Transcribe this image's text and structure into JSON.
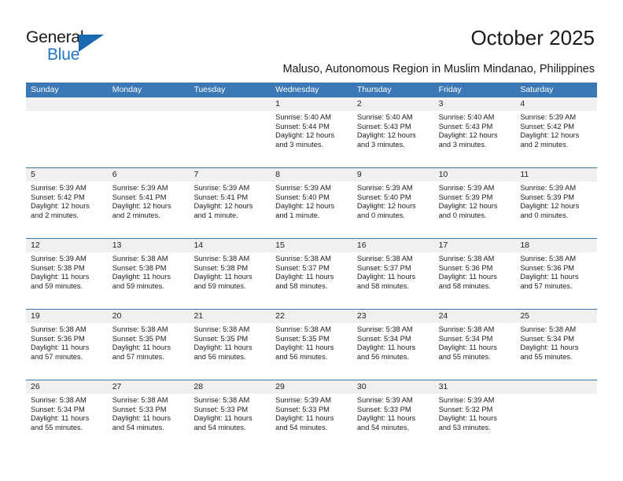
{
  "logo": {
    "word1": "General",
    "word2": "Blue",
    "triangle_color": "#1b69b0",
    "blue_color": "#2077c0"
  },
  "header": {
    "title": "October 2025",
    "subtitle": "Maluso, Autonomous Region in Muslim Mindanao, Philippines"
  },
  "theme": {
    "header_blue": "#3b78b5",
    "daynum_band": "#f0f0f0",
    "text": "#1e1e1e"
  },
  "calendar": {
    "weekday_headers": [
      "Sunday",
      "Monday",
      "Tuesday",
      "Wednesday",
      "Thursday",
      "Friday",
      "Saturday"
    ],
    "weeks": [
      [
        {
          "day": "",
          "lines": []
        },
        {
          "day": "",
          "lines": []
        },
        {
          "day": "",
          "lines": []
        },
        {
          "day": "1",
          "lines": [
            "Sunrise: 5:40 AM",
            "Sunset: 5:44 PM",
            "Daylight: 12 hours",
            "and 3 minutes."
          ]
        },
        {
          "day": "2",
          "lines": [
            "Sunrise: 5:40 AM",
            "Sunset: 5:43 PM",
            "Daylight: 12 hours",
            "and 3 minutes."
          ]
        },
        {
          "day": "3",
          "lines": [
            "Sunrise: 5:40 AM",
            "Sunset: 5:43 PM",
            "Daylight: 12 hours",
            "and 3 minutes."
          ]
        },
        {
          "day": "4",
          "lines": [
            "Sunrise: 5:39 AM",
            "Sunset: 5:42 PM",
            "Daylight: 12 hours",
            "and 2 minutes."
          ]
        }
      ],
      [
        {
          "day": "5",
          "lines": [
            "Sunrise: 5:39 AM",
            "Sunset: 5:42 PM",
            "Daylight: 12 hours",
            "and 2 minutes."
          ]
        },
        {
          "day": "6",
          "lines": [
            "Sunrise: 5:39 AM",
            "Sunset: 5:41 PM",
            "Daylight: 12 hours",
            "and 2 minutes."
          ]
        },
        {
          "day": "7",
          "lines": [
            "Sunrise: 5:39 AM",
            "Sunset: 5:41 PM",
            "Daylight: 12 hours",
            "and 1 minute."
          ]
        },
        {
          "day": "8",
          "lines": [
            "Sunrise: 5:39 AM",
            "Sunset: 5:40 PM",
            "Daylight: 12 hours",
            "and 1 minute."
          ]
        },
        {
          "day": "9",
          "lines": [
            "Sunrise: 5:39 AM",
            "Sunset: 5:40 PM",
            "Daylight: 12 hours",
            "and 0 minutes."
          ]
        },
        {
          "day": "10",
          "lines": [
            "Sunrise: 5:39 AM",
            "Sunset: 5:39 PM",
            "Daylight: 12 hours",
            "and 0 minutes."
          ]
        },
        {
          "day": "11",
          "lines": [
            "Sunrise: 5:39 AM",
            "Sunset: 5:39 PM",
            "Daylight: 12 hours",
            "and 0 minutes."
          ]
        }
      ],
      [
        {
          "day": "12",
          "lines": [
            "Sunrise: 5:39 AM",
            "Sunset: 5:38 PM",
            "Daylight: 11 hours",
            "and 59 minutes."
          ]
        },
        {
          "day": "13",
          "lines": [
            "Sunrise: 5:38 AM",
            "Sunset: 5:38 PM",
            "Daylight: 11 hours",
            "and 59 minutes."
          ]
        },
        {
          "day": "14",
          "lines": [
            "Sunrise: 5:38 AM",
            "Sunset: 5:38 PM",
            "Daylight: 11 hours",
            "and 59 minutes."
          ]
        },
        {
          "day": "15",
          "lines": [
            "Sunrise: 5:38 AM",
            "Sunset: 5:37 PM",
            "Daylight: 11 hours",
            "and 58 minutes."
          ]
        },
        {
          "day": "16",
          "lines": [
            "Sunrise: 5:38 AM",
            "Sunset: 5:37 PM",
            "Daylight: 11 hours",
            "and 58 minutes."
          ]
        },
        {
          "day": "17",
          "lines": [
            "Sunrise: 5:38 AM",
            "Sunset: 5:36 PM",
            "Daylight: 11 hours",
            "and 58 minutes."
          ]
        },
        {
          "day": "18",
          "lines": [
            "Sunrise: 5:38 AM",
            "Sunset: 5:36 PM",
            "Daylight: 11 hours",
            "and 57 minutes."
          ]
        }
      ],
      [
        {
          "day": "19",
          "lines": [
            "Sunrise: 5:38 AM",
            "Sunset: 5:36 PM",
            "Daylight: 11 hours",
            "and 57 minutes."
          ]
        },
        {
          "day": "20",
          "lines": [
            "Sunrise: 5:38 AM",
            "Sunset: 5:35 PM",
            "Daylight: 11 hours",
            "and 57 minutes."
          ]
        },
        {
          "day": "21",
          "lines": [
            "Sunrise: 5:38 AM",
            "Sunset: 5:35 PM",
            "Daylight: 11 hours",
            "and 56 minutes."
          ]
        },
        {
          "day": "22",
          "lines": [
            "Sunrise: 5:38 AM",
            "Sunset: 5:35 PM",
            "Daylight: 11 hours",
            "and 56 minutes."
          ]
        },
        {
          "day": "23",
          "lines": [
            "Sunrise: 5:38 AM",
            "Sunset: 5:34 PM",
            "Daylight: 11 hours",
            "and 56 minutes."
          ]
        },
        {
          "day": "24",
          "lines": [
            "Sunrise: 5:38 AM",
            "Sunset: 5:34 PM",
            "Daylight: 11 hours",
            "and 55 minutes."
          ]
        },
        {
          "day": "25",
          "lines": [
            "Sunrise: 5:38 AM",
            "Sunset: 5:34 PM",
            "Daylight: 11 hours",
            "and 55 minutes."
          ]
        }
      ],
      [
        {
          "day": "26",
          "lines": [
            "Sunrise: 5:38 AM",
            "Sunset: 5:34 PM",
            "Daylight: 11 hours",
            "and 55 minutes."
          ]
        },
        {
          "day": "27",
          "lines": [
            "Sunrise: 5:38 AM",
            "Sunset: 5:33 PM",
            "Daylight: 11 hours",
            "and 54 minutes."
          ]
        },
        {
          "day": "28",
          "lines": [
            "Sunrise: 5:38 AM",
            "Sunset: 5:33 PM",
            "Daylight: 11 hours",
            "and 54 minutes."
          ]
        },
        {
          "day": "29",
          "lines": [
            "Sunrise: 5:39 AM",
            "Sunset: 5:33 PM",
            "Daylight: 11 hours",
            "and 54 minutes."
          ]
        },
        {
          "day": "30",
          "lines": [
            "Sunrise: 5:39 AM",
            "Sunset: 5:33 PM",
            "Daylight: 11 hours",
            "and 54 minutes."
          ]
        },
        {
          "day": "31",
          "lines": [
            "Sunrise: 5:39 AM",
            "Sunset: 5:32 PM",
            "Daylight: 11 hours",
            "and 53 minutes."
          ]
        },
        {
          "day": "",
          "lines": []
        }
      ]
    ]
  }
}
